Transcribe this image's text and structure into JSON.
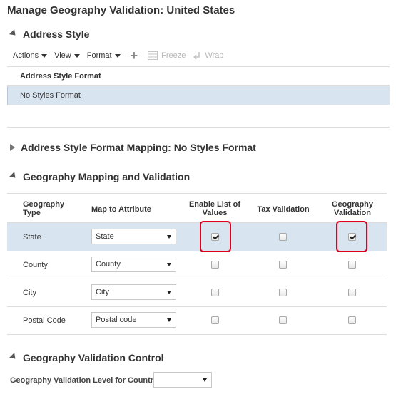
{
  "page": {
    "title": "Manage Geography Validation: United States"
  },
  "address_style": {
    "section_title": "Address Style",
    "toolbar": {
      "actions_label": "Actions",
      "view_label": "View",
      "format_label": "Format",
      "add_icon": "plus-icon",
      "freeze_label": "Freeze",
      "wrap_label": "Wrap"
    },
    "table": {
      "column_header": "Address Style Format",
      "rows": [
        {
          "format": "No Styles Format",
          "selected": true
        }
      ]
    }
  },
  "mapping": {
    "section_title": "Address Style Format Mapping: No Styles Format",
    "expanded": false
  },
  "geography": {
    "section_title": "Geography Mapping and Validation",
    "columns": {
      "geography_type": "Geography Type",
      "map_to_attribute": "Map to Attribute",
      "enable_list": "Enable List of Values",
      "tax_validation": "Tax Validation",
      "geography_validation": "Geography Validation"
    },
    "rows": [
      {
        "type": "State",
        "attribute": "State",
        "enable_list": true,
        "tax_validation": false,
        "geography_validation": true,
        "selected": true
      },
      {
        "type": "County",
        "attribute": "County",
        "enable_list": false,
        "tax_validation": false,
        "geography_validation": false,
        "selected": false
      },
      {
        "type": "City",
        "attribute": "City",
        "enable_list": false,
        "tax_validation": false,
        "geography_validation": false,
        "selected": false
      },
      {
        "type": "Postal Code",
        "attribute": "Postal code",
        "enable_list": false,
        "tax_validation": false,
        "geography_validation": false,
        "selected": false
      }
    ]
  },
  "validation_control": {
    "section_title": "Geography Validation Control",
    "level_label": "Geography Validation Level for Country",
    "level_value": ""
  },
  "colors": {
    "selected_row": "#d8e4f0",
    "highlight": "#e0001b"
  }
}
